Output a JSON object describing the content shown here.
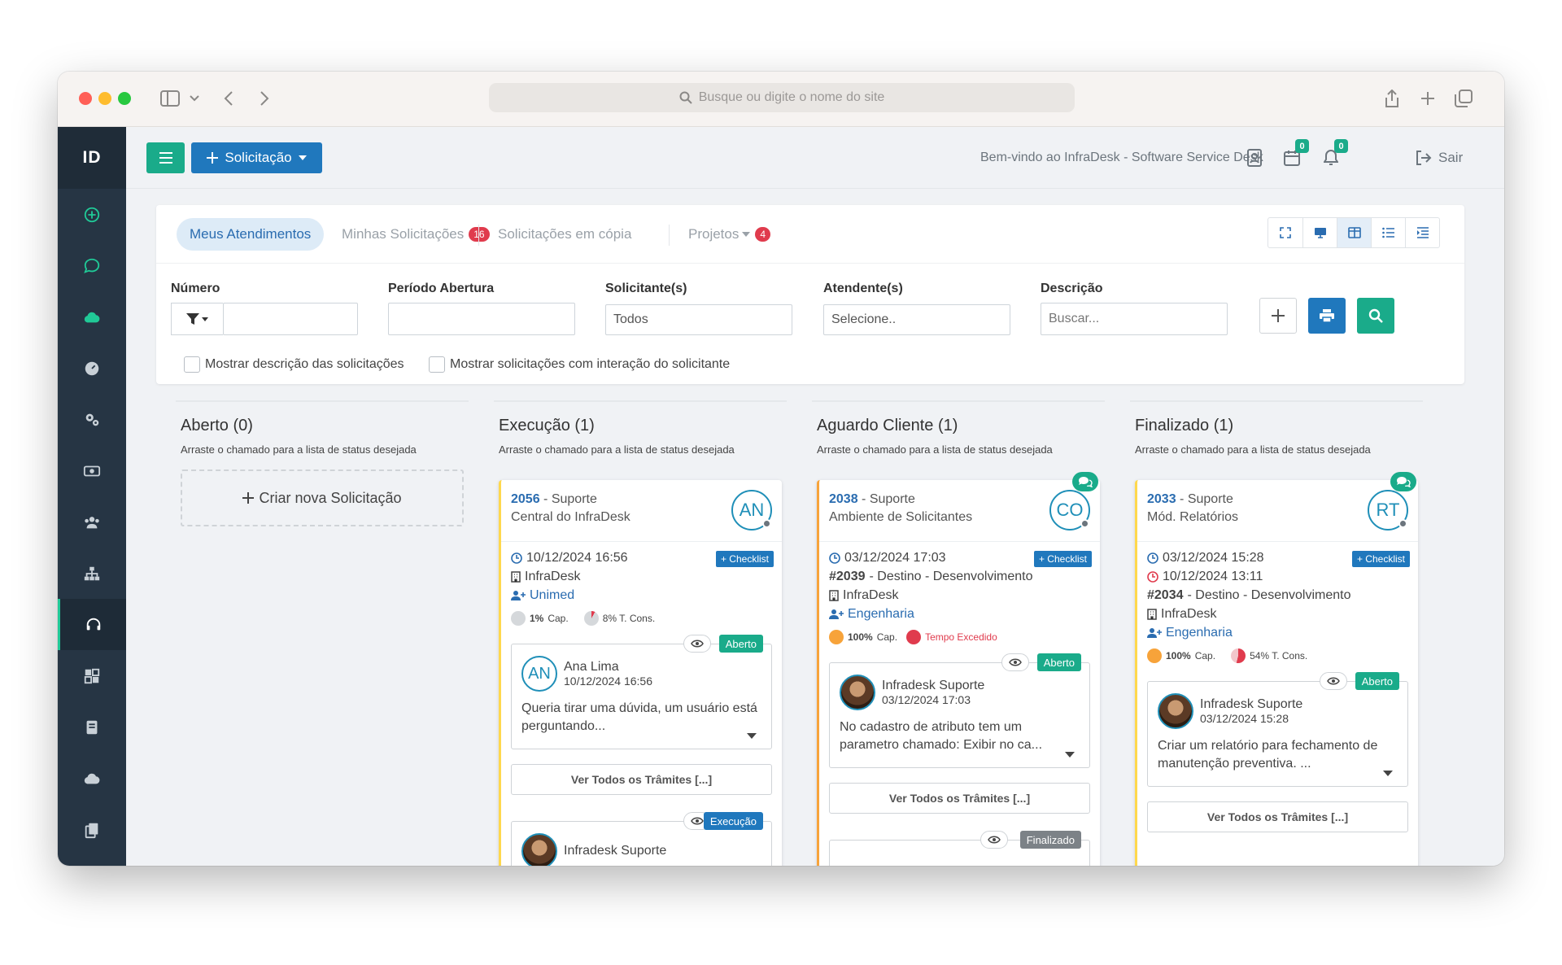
{
  "browser": {
    "url_placeholder": "Busque ou digite o nome do site"
  },
  "brand": "ID",
  "topbar": {
    "new_label": "Solicitação",
    "welcome": "Bem-vindo ao InfraDesk - Software Service Desk",
    "calendar_badge": "0",
    "bell_badge": "0",
    "logout_label": "Sair"
  },
  "tabs": [
    {
      "label": "Meus Atendimentos"
    },
    {
      "label": "Minhas Solicitações",
      "count": "16"
    },
    {
      "label": "Solicitações em cópia"
    },
    {
      "label": "Projetos",
      "count": "4"
    }
  ],
  "filters": {
    "numero_label": "Número",
    "periodo_label": "Período Abertura",
    "solicitante_label": "Solicitante(s)",
    "solicitante_value": "Todos",
    "atendente_label": "Atendente(s)",
    "atendente_value": "Selecione..",
    "descricao_label": "Descrição",
    "descricao_placeholder": "Buscar...",
    "check1": "Mostrar descrição das solicitações",
    "check2": "Mostrar solicitações com interação do solicitante"
  },
  "columns": {
    "aberto": {
      "title": "Aberto (0)",
      "sub": "Arraste o chamado para a lista de status desejada",
      "create": "Criar nova Solicitação"
    },
    "execucao": {
      "title": "Execução (1)",
      "sub": "Arraste o chamado para a lista de status desejada"
    },
    "aguardo": {
      "title": "Aguardo Cliente (1)",
      "sub": "Arraste o chamado para a lista de status desejada"
    },
    "finalizado": {
      "title": "Finalizado (1)",
      "sub": "Arraste o chamado para a lista de status desejada"
    }
  },
  "tickets": {
    "t2056": {
      "number": "2056",
      "type": "- Suporte",
      "area": "Central do InfraDesk",
      "initials": "AN",
      "date": "10/12/2024 16:56",
      "checklist": "+ Checklist",
      "company": "InfraDesk",
      "client": "Unimed",
      "cap": "1%",
      "cap_label": "Cap.",
      "cons": "8% T. Cons.",
      "inter1": {
        "status": "Aberto",
        "initials": "AN",
        "name": "Ana Lima",
        "date": "10/12/2024 16:56",
        "text": "Queria tirar uma dúvida, um usuário está perguntando..."
      },
      "all_label": "Ver Todos os Trâmites [...]",
      "inter2": {
        "status": "Execução",
        "name": "Infradesk Suporte"
      }
    },
    "t2038": {
      "number": "2038",
      "type": "- Suporte",
      "area": "Ambiente de Solicitantes",
      "initials": "CO",
      "date": "03/12/2024 17:03",
      "checklist": "+ Checklist",
      "dest_num": "#2039",
      "dest": "- Destino - Desenvolvimento",
      "company": "InfraDesk",
      "client": "Engenharia",
      "cap": "100%",
      "cap_label": "Cap.",
      "exceeded": "Tempo Excedido",
      "inter1": {
        "status": "Aberto",
        "name": "Infradesk Suporte",
        "date": "03/12/2024 17:03",
        "text": "No cadastro de atributo tem um parametro chamado: Exibir no ca..."
      },
      "all_label": "Ver Todos os Trâmites [...]",
      "inter2": {
        "status": "Finalizado"
      }
    },
    "t2033": {
      "number": "2033",
      "type": "- Suporte",
      "area": "Mód. Relatórios",
      "initials": "RT",
      "date": "03/12/2024 15:28",
      "date2": "10/12/2024 13:11",
      "checklist": "+ Checklist",
      "dest_num": "#2034",
      "dest": "- Destino - Desenvolvimento",
      "company": "InfraDesk",
      "client": "Engenharia",
      "cap": "100%",
      "cap_label": "Cap.",
      "cons": "54% T. Cons.",
      "inter1": {
        "status": "Aberto",
        "name": "Infradesk Suporte",
        "date": "03/12/2024 15:28",
        "text": "Criar um relatório para fechamento de manutenção preventiva. ..."
      },
      "all_label": "Ver Todos os Trâmites [...]"
    }
  },
  "colors": {
    "sidebar": "#263544",
    "accent_green": "#1aab8a",
    "accent_blue": "#2078bd",
    "danger": "#e03b4d",
    "warning": "#f7a33a",
    "ticket_border": "#ffd84d"
  }
}
